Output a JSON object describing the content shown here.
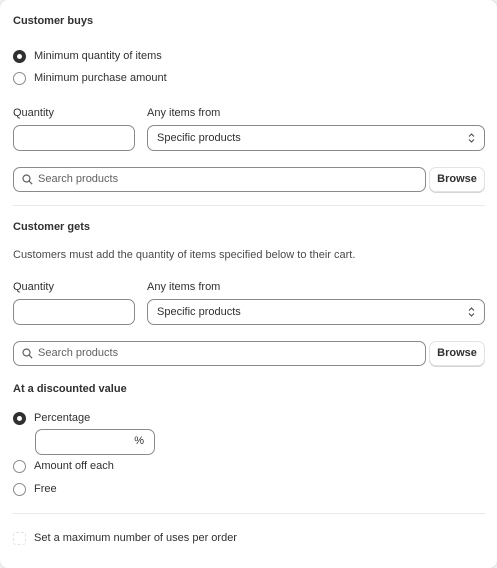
{
  "customer_buys": {
    "heading": "Customer buys",
    "options": [
      {
        "label": "Minimum quantity of items",
        "checked": true
      },
      {
        "label": "Minimum purchase amount",
        "checked": false
      }
    ],
    "quantity_label": "Quantity",
    "quantity_value": "",
    "items_from_label": "Any items from",
    "items_from_value": "Specific products",
    "search_placeholder": "Search products",
    "browse_label": "Browse"
  },
  "customer_gets": {
    "heading": "Customer gets",
    "description": "Customers must add the quantity of items specified below to their cart.",
    "quantity_label": "Quantity",
    "quantity_value": "",
    "items_from_label": "Any items from",
    "items_from_value": "Specific products",
    "search_placeholder": "Search products",
    "browse_label": "Browse"
  },
  "discounted_value": {
    "heading": "At a discounted value",
    "options": [
      {
        "label": "Percentage",
        "checked": true
      },
      {
        "label": "Amount off each",
        "checked": false
      },
      {
        "label": "Free",
        "checked": false
      }
    ],
    "percentage_value": "",
    "percentage_suffix": "%"
  },
  "max_uses": {
    "label": "Set a maximum number of uses per order",
    "checked": false
  }
}
